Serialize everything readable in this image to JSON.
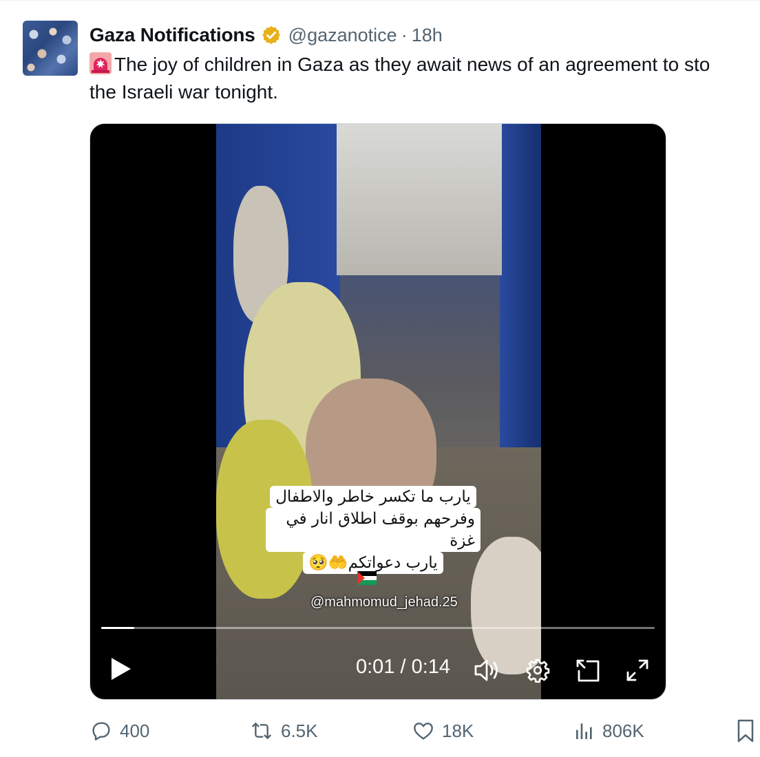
{
  "tweet": {
    "display_name": "Gaza Notifications",
    "handle": "@gazanotice",
    "separator": "·",
    "time": "18h",
    "text_line1": "The joy of children in Gaza as they await news of an agreement to sto",
    "text_line2": "the Israeli war tonight.",
    "siren_icon": "rotating-light-icon"
  },
  "video": {
    "caption_lines": [
      "يارب ما تكسر خاطر والاطفال",
      "وفرحهم بوقف اطلاق انار في غزة",
      "يارب دعواتكم🤲🥺"
    ],
    "watermark": "@mahmomud_jehad.25",
    "time_readout": "0:01 / 0:14",
    "progress_fraction": 0.06,
    "controls": [
      "play-icon",
      "volume-icon",
      "settings-icon",
      "picture-in-picture-icon",
      "fullscreen-icon"
    ]
  },
  "actions": {
    "replies": "400",
    "reposts": "6.5K",
    "likes": "18K",
    "views": "806K"
  },
  "colors": {
    "text": "#0f1419",
    "muted": "#536471",
    "verified_gold": "#e8b11a",
    "siren_red": "#e0245e"
  }
}
